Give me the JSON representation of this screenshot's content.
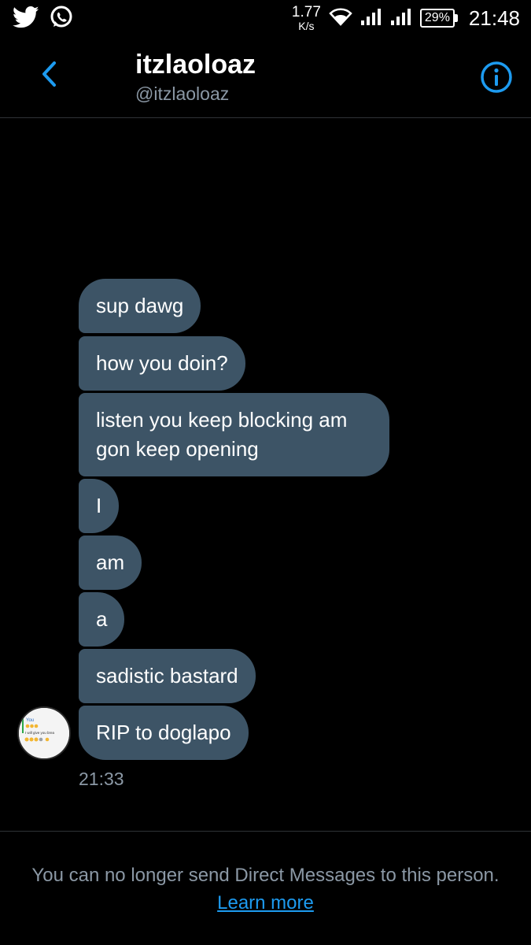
{
  "status_bar": {
    "net_speed_value": "1.77",
    "net_speed_unit": "K/s",
    "battery_percent": "29%",
    "time": "21:48",
    "icons": [
      "twitter-icon",
      "whatsapp-icon",
      "wifi-icon",
      "signal-icon",
      "signal-icon",
      "battery-icon"
    ]
  },
  "header": {
    "display_name": "itzlaoloaz",
    "handle": "@itzlaoloaz",
    "back_icon": "chevron-left-icon",
    "info_icon": "info-icon",
    "accent_color": "#1d9bf0"
  },
  "messages": [
    {
      "text": "sup dawg"
    },
    {
      "text": "how you doin?"
    },
    {
      "text": "listen you keep blocking am gon keep opening"
    },
    {
      "text": "I"
    },
    {
      "text": "am"
    },
    {
      "text": "a"
    },
    {
      "text": "sadistic bastard"
    },
    {
      "text": "RIP to doglapo"
    }
  ],
  "avatar_image": {
    "line1": "You",
    "line2": "I will give you brea"
  },
  "timestamp": "21:33",
  "footer": {
    "notice": "You can no longer send Direct Messages to this person.",
    "link": "Learn more"
  },
  "colors": {
    "background": "#000000",
    "bubble": "#3d5466",
    "secondary_text": "#8b98a5",
    "link": "#1d9bf0"
  }
}
